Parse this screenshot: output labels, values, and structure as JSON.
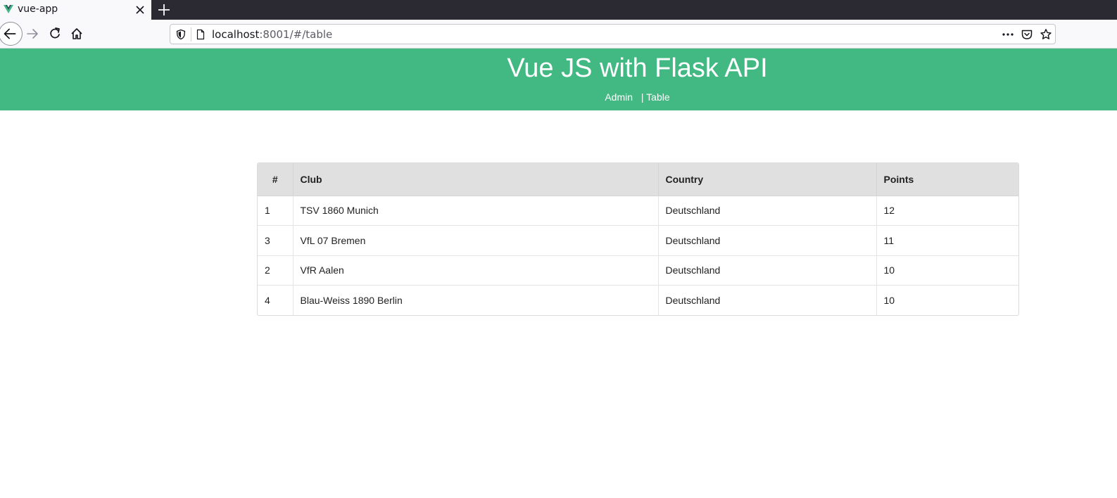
{
  "browser": {
    "tab_title": "vue-app",
    "url_host": "localhost",
    "url_rest": ":8001/#/table"
  },
  "header": {
    "title": "Vue JS with Flask API",
    "nav": [
      {
        "label": "Admin"
      },
      {
        "label": "| Table"
      }
    ],
    "color": "#42b883"
  },
  "table": {
    "columns": [
      "#",
      "Club",
      "Country",
      "Points"
    ],
    "rows": [
      {
        "num": "1",
        "club": "TSV 1860 Munich",
        "country": "Deutschland",
        "points": "12"
      },
      {
        "num": "3",
        "club": "VfL 07 Bremen",
        "country": "Deutschland",
        "points": "11"
      },
      {
        "num": "2",
        "club": "VfR Aalen",
        "country": "Deutschland",
        "points": "10"
      },
      {
        "num": "4",
        "club": "Blau-Weiss 1890 Berlin",
        "country": "Deutschland",
        "points": "10"
      }
    ]
  },
  "icons": {
    "favicon": "vue-logo-icon",
    "close": "close-icon",
    "new_tab": "plus-icon",
    "back": "arrow-left-icon",
    "forward": "arrow-right-icon",
    "reload": "reload-icon",
    "home": "home-icon",
    "shield": "shield-icon",
    "page": "page-icon",
    "more": "more-icon",
    "pocket": "pocket-icon",
    "bookmark": "star-icon"
  }
}
